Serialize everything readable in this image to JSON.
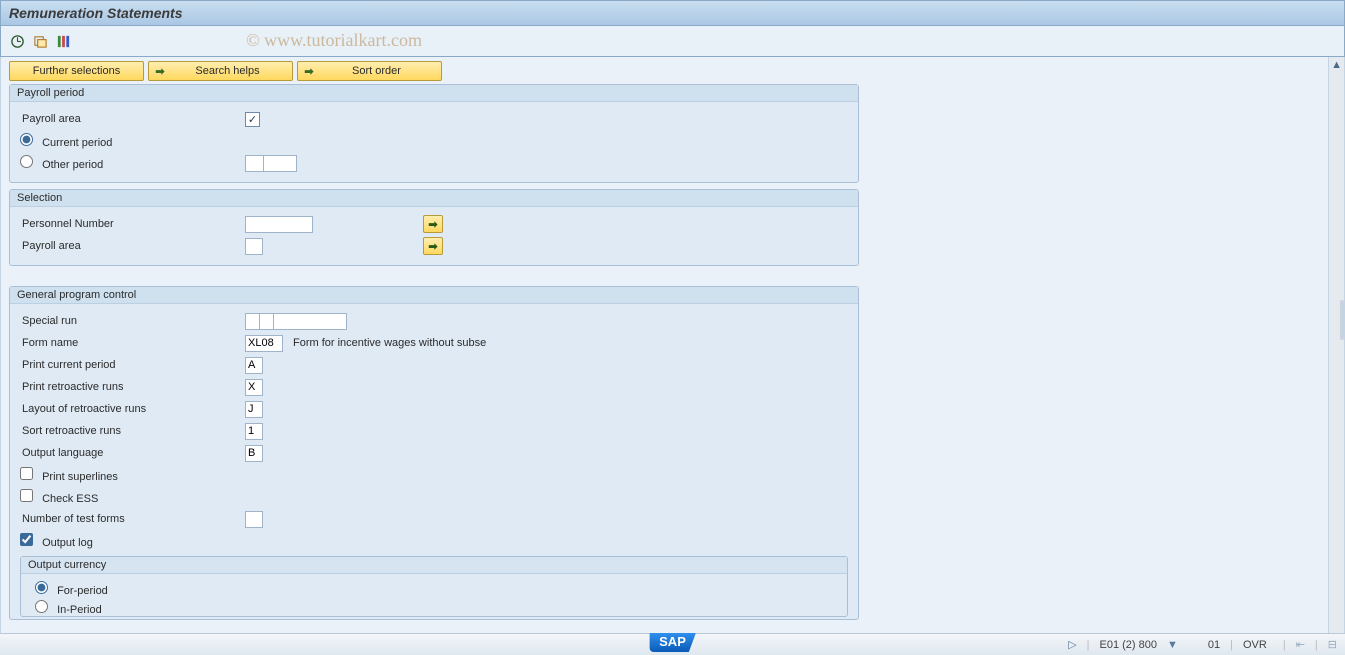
{
  "title": "Remuneration Statements",
  "watermark": "© www.tutorialkart.com",
  "buttons": {
    "further_selections": "Further selections",
    "search_helps": "Search helps",
    "sort_order": "Sort order"
  },
  "group_payroll": {
    "title": "Payroll period",
    "payroll_area_label": "Payroll area",
    "current_period_label": "Current period",
    "other_period_label": "Other period"
  },
  "group_selection": {
    "title": "Selection",
    "personnel_number_label": "Personnel Number",
    "payroll_area_label": "Payroll area"
  },
  "group_general": {
    "title": "General program control",
    "special_run_label": "Special run",
    "form_name_label": "Form name",
    "form_name_value": "XL08",
    "form_name_desc": "Form for incentive wages without subse",
    "print_current_label": "Print current period",
    "print_current_value": "A",
    "print_retro_label": "Print retroactive runs",
    "print_retro_value": "X",
    "layout_retro_label": "Layout of retroactive runs",
    "layout_retro_value": "J",
    "sort_retro_label": "Sort retroactive runs",
    "sort_retro_value": "1",
    "output_lang_label": "Output language",
    "output_lang_value": "B",
    "print_superlines_label": "Print superlines",
    "check_ess_label": "Check ESS",
    "num_test_forms_label": "Number of test forms",
    "output_log_label": "Output log",
    "output_currency_title": "Output currency",
    "for_period_label": "For-period",
    "in_period_label": "In-Period"
  },
  "status": {
    "system": "E01 (2) 800",
    "client": "01",
    "mode": "OVR"
  }
}
